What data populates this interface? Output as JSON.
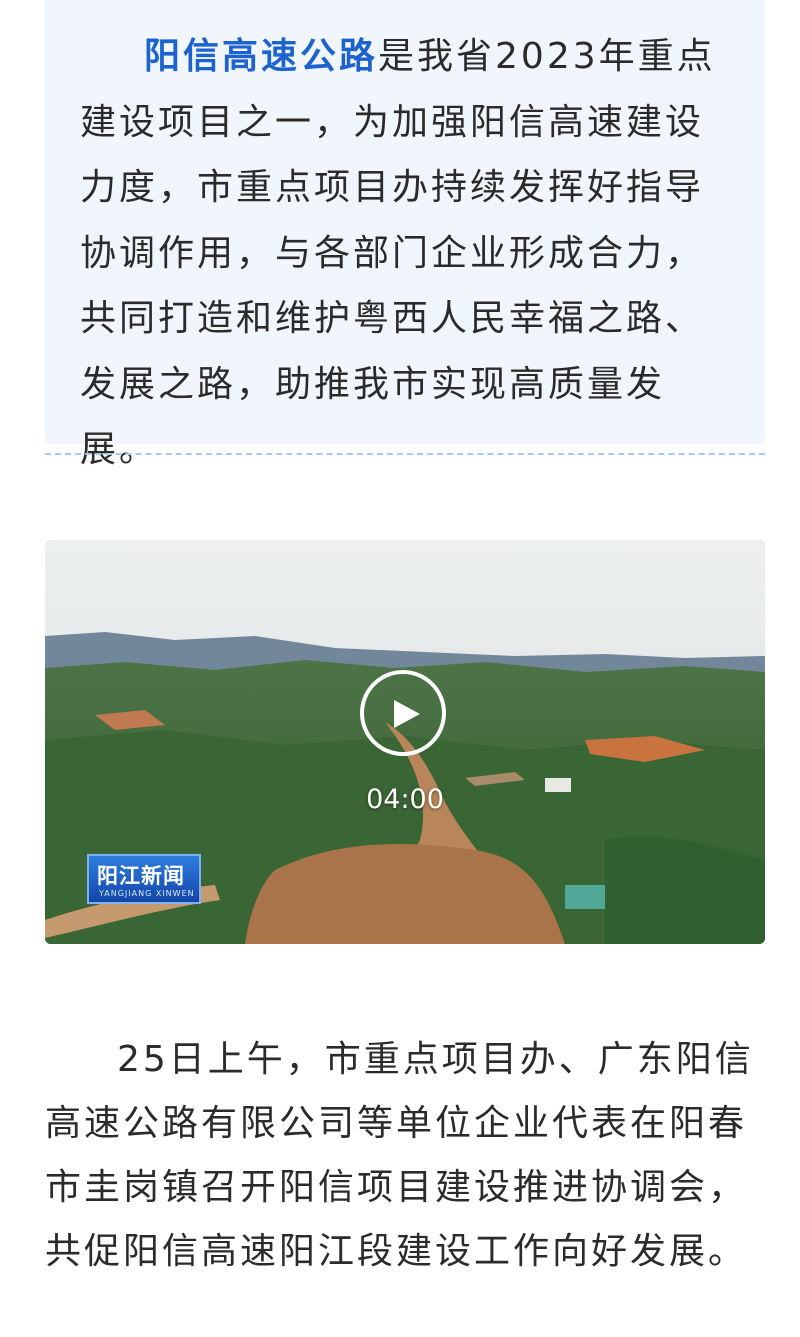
{
  "intro": {
    "highlight": "阳信高速公路",
    "text": "是我省2023年重点建设项目之一，为加强阳信高速建设力度，市重点项目办持续发挥好指导协调作用，与各部门企业形成合力，共同打造和维护粤西人民幸福之路、发展之路，助推我市实现高质量发展。"
  },
  "video": {
    "duration": "04:00",
    "logo_text": "阳江新闻",
    "logo_subtext": "YANGJIANG XINWEN",
    "play_icon": "play-icon"
  },
  "body": {
    "paragraph": "25日上午，市重点项目办、广东阳信高速公路有限公司等单位企业代表在阳春市圭岗镇召开阳信项目建设推进协调会，共促阳信高速阳江段建设工作向好发展。"
  },
  "colors": {
    "highlight": "#1d63cf",
    "intro_background": "#f1f6fd",
    "divider": "#a9c8ef",
    "text": "#2b2b2b"
  }
}
